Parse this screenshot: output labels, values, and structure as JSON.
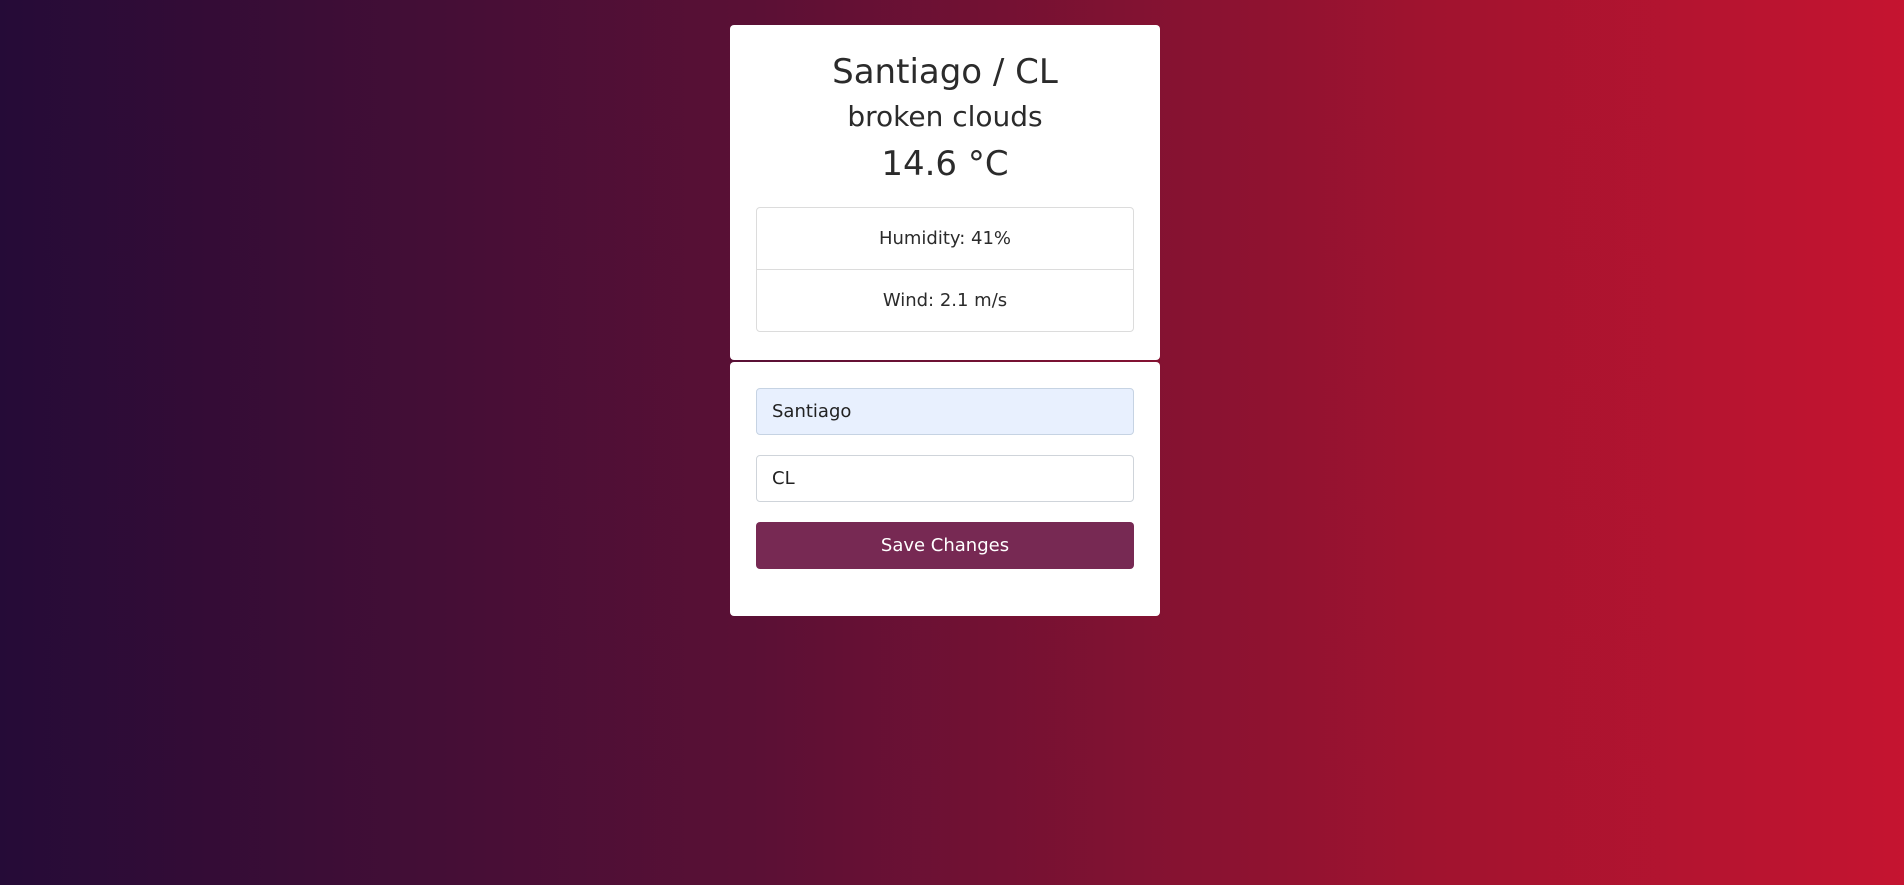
{
  "weather": {
    "location": "Santiago / CL",
    "description": "broken clouds",
    "temperature": "14.6 °C",
    "humidity": "Humidity: 41%",
    "wind": "Wind: 2.1 m/s"
  },
  "form": {
    "city_value": "Santiago",
    "country_value": "CL",
    "save_label": "Save Changes"
  },
  "colors": {
    "gradient_start": "#250b37",
    "gradient_end": "#c51430",
    "button": "#772953",
    "autofill_background": "#e8f0fe"
  }
}
